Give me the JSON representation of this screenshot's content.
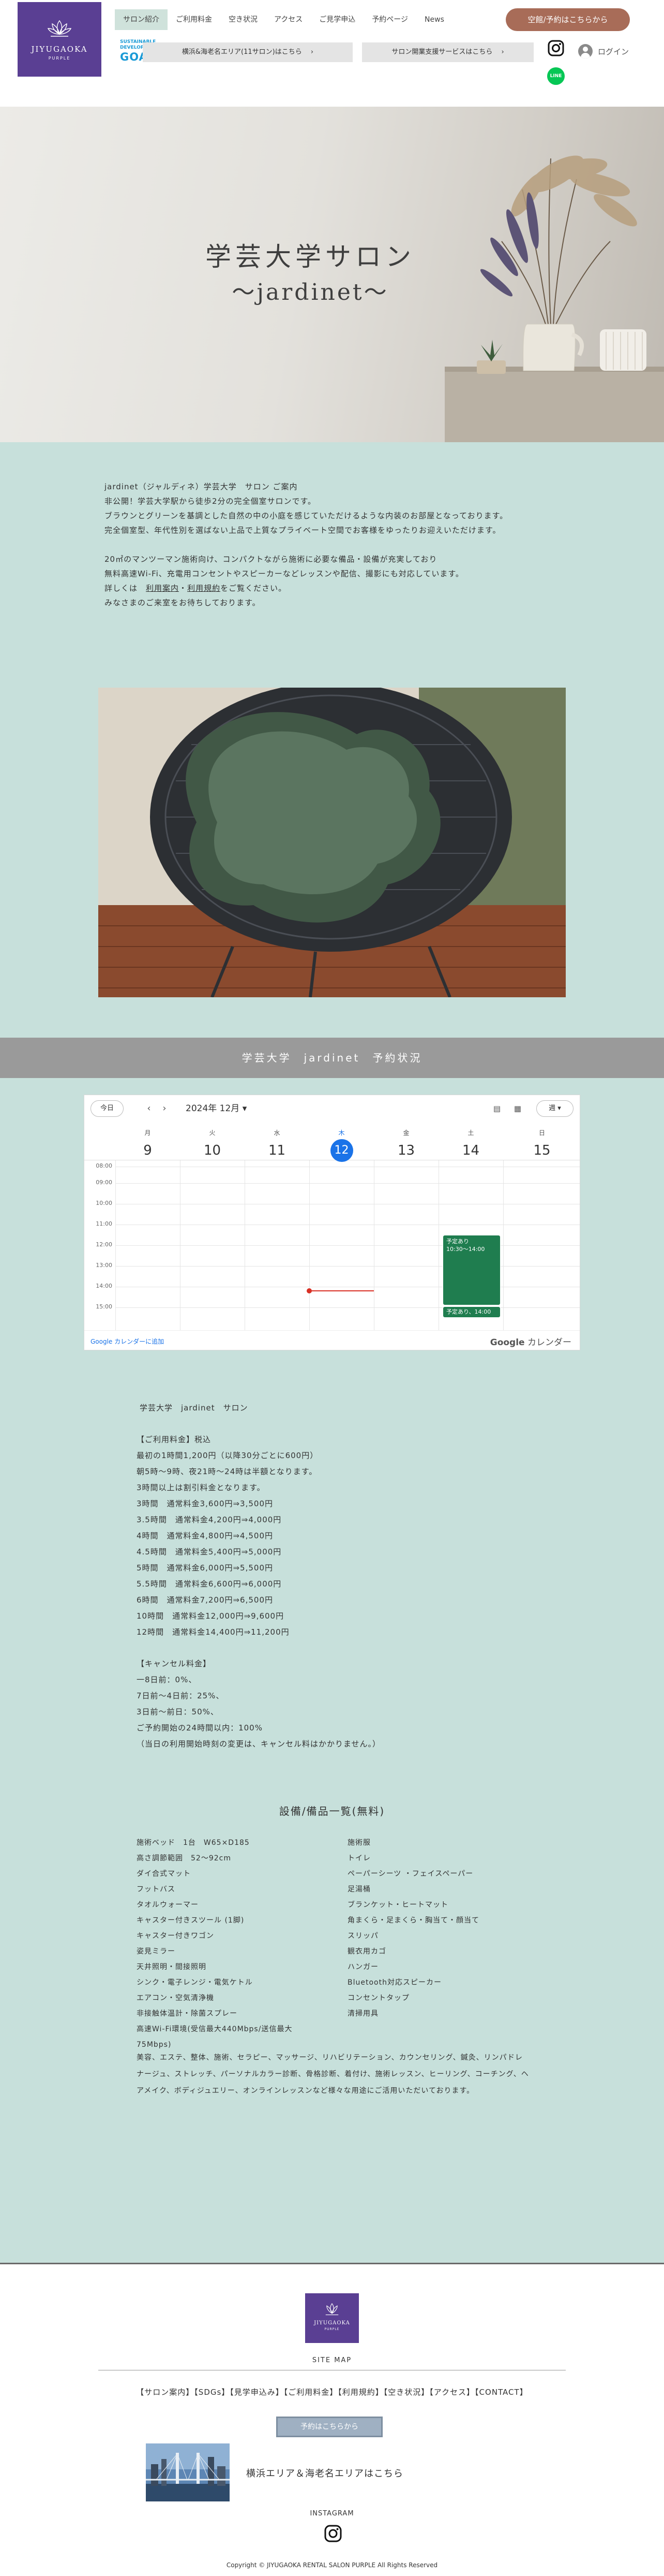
{
  "header": {
    "logo": {
      "title": "JIYUGAOKA",
      "subtitle": "PURPLE"
    },
    "nav": [
      "サロン紹介",
      "ご利用料金",
      "空き状況",
      "アクセス",
      "ご見学申込",
      "予約ページ",
      "News"
    ],
    "book_button": "空館/予約はこちらから",
    "sdgs": {
      "line1": "SUSTAINABLE",
      "line2": "DEVELOPMENT",
      "line3": "GOALS"
    },
    "area_button_1": "横浜&海老名エリア(11サロン)はこちら",
    "area_button_2": "サロン開業支援サービスはこちら",
    "line_label": "LINE",
    "login_label": "ログイン"
  },
  "hero": {
    "title": "学芸大学サロン",
    "subtitle": "〜jardinet〜"
  },
  "description": {
    "p1": [
      "jardinet（ジャルディネ）学芸大学　サロン ご案内",
      "非公開！学芸大学駅から徒歩2分の完全個室サロンです。",
      "ブラウンとグリーンを基調とした自然の中の小庭を感じていただけるような内装のお部屋となっております。",
      "完全個室型、年代性別を選ばない上品で上質なプライベート空間でお客様をゆったりお迎えいただけます。"
    ],
    "p2": [
      "20㎡のマンツーマン施術向け、コンパクトながら施術に必要な備品・設備が充実しており",
      "無料高速Wi-Fi、充電用コンセントやスピーカーなどレッスンや配信、撮影にも対応しています。"
    ],
    "detail_prefix": "詳しくは",
    "link1": "利用案内",
    "sep": "・",
    "link2": "利用規約",
    "detail_suffix": "をご覧ください。",
    "closing": "みなさまのご来室をお待ちしております。"
  },
  "band": {
    "title": "学芸大学　jardinet　予約状況"
  },
  "calendar": {
    "today_button": "今日",
    "prev": "‹",
    "next": "›",
    "month": "2024年 12月 ▾",
    "view": "週 ▾",
    "days": [
      {
        "dow": "月",
        "num": "9"
      },
      {
        "dow": "火",
        "num": "10"
      },
      {
        "dow": "水",
        "num": "11"
      },
      {
        "dow": "木",
        "num": "12"
      },
      {
        "dow": "金",
        "num": "13"
      },
      {
        "dow": "土",
        "num": "14"
      },
      {
        "dow": "日",
        "num": "15"
      }
    ],
    "hours": [
      "08:00",
      "09:00",
      "10:00",
      "11:00",
      "12:00",
      "13:00",
      "14:00",
      "15:00"
    ],
    "events": [
      {
        "title": "予定あり",
        "time": "10:30〜14:00"
      },
      {
        "title": "予定あり、14:00",
        "time": ""
      }
    ],
    "add_link": "Google カレンダーに追加",
    "brand_google": "Google",
    "brand_suffix": " カレンダー"
  },
  "pricing": {
    "salon_name": "学芸大学　jardinet　サロン",
    "fee_heading": "【ご利用料金】税込",
    "fee_lines": [
      "最初の1時間1,200円（以降30分ごとに600円）",
      "朝5時〜9時、夜21時〜24時は半額となります。",
      "3時間以上は割引料金となります。",
      "3時間　通常料金3,600円⇒3,500円",
      "3.5時間　通常料金4,200円⇒4,000円",
      "4時間　通常料金4,800円⇒4,500円",
      "4.5時間　通常料金5,400円⇒5,000円",
      "5時間　通常料金6,000円⇒5,500円",
      "5.5時間　通常料金6,600円⇒6,000円",
      "6時間　通常料金7,200円⇒6,500円",
      "10時間　通常料金12,000円⇒9,600円",
      "12時間　通常料金14,400円⇒11,200円"
    ],
    "cancel_heading": "【キャンセル料金】",
    "cancel_lines": [
      "一8日前：0%、",
      "7日前〜4日前：25%、",
      "3日前〜前日：50%、",
      "ご予約開始の24時間以内：100%",
      "（当日の利用開始時刻の変更は、キャンセル料はかかりません。）"
    ]
  },
  "equipment": {
    "title": "設備/備品一覧(無料)",
    "left": [
      "施術ベッド　1台　W65×D185",
      "高さ調節範囲　52〜92cm",
      "ダイ合式マット",
      "フットバス",
      "タオルウォーマー",
      "キャスター付きスツール (1脚)",
      "キャスター付きワゴン",
      "姿見ミラー",
      "天井照明・間接照明",
      "シンク・電子レンジ・電気ケトル",
      "エアコン・空気清浄機",
      "非接触体温計・除菌スプレー",
      "高速Wi-Fi環境(受信最大440Mbps/送信最大",
      "75Mbps)"
    ],
    "right": [
      "施術服",
      "トイレ",
      "ペーパーシーツ ・フェイスペーパー",
      "足湯桶",
      "ブランケット・ヒートマット",
      "角まくら・足まくら・胸当て・顔当て",
      "スリッパ",
      "観衣用カゴ",
      "ハンガー",
      "Bluetooth対応スピーカー",
      "コンセントタップ",
      "清掃用具"
    ]
  },
  "uses": "美容、エステ、整体、施術、セラピー、マッサージ、リハビリテーション、カウンセリング、鍼灸、リンパドレナージュ、ストレッチ、パーソナルカラー診断、骨格診断、着付け、施術レッスン、ヒーリング、コーチング、ヘアメイク、ボディジュエリー、オンラインレッスンなど様々な用途にご活用いただいております。",
  "footer": {
    "logo_title": "JIYUGAOKA",
    "logo_sub": "PURPLE",
    "sitemap": "SITE MAP",
    "links": "【サロン案内】【SDGs】【見学申込み】【ご利用料金】【利用規約】【空き状況】【アクセス】【CONTACT】",
    "booking_button": "予約はこちらから",
    "area_link": "横浜エリア＆海老名エリアはこちら",
    "instagram_label": "INSTAGRAM",
    "copyright": "Copyright © JIYUGAOKA RENTAL SALON PURPLE All Rights Reserved"
  },
  "colors": {
    "brand_purple": "#5a3f93",
    "mint": "#c7e0db",
    "book_button": "#a86c58",
    "band_gray": "#9a9a9a",
    "event_green": "#1f7d4f",
    "today_blue": "#1a73e8"
  }
}
